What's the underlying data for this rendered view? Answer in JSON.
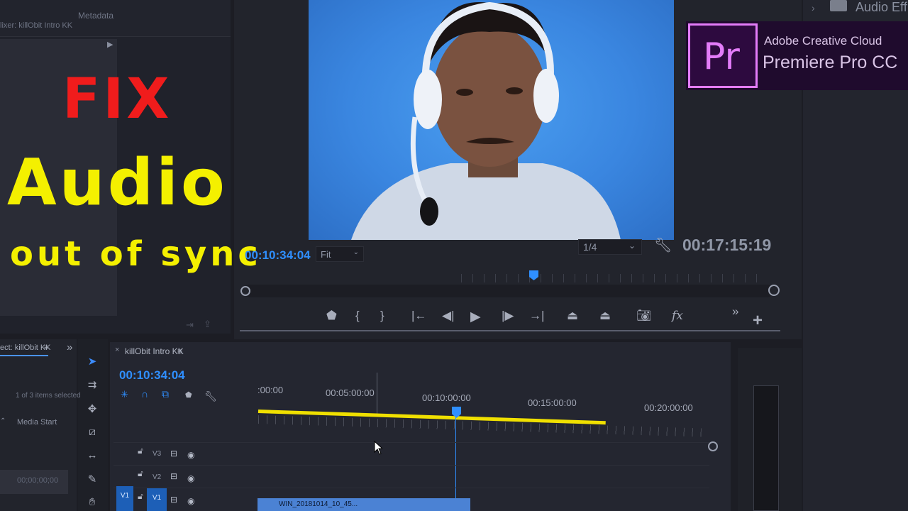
{
  "overlay": {
    "line1": "FIX",
    "line2": "Audio",
    "line3": "out of sync"
  },
  "logo": {
    "badge": "Pr",
    "line1": "Adobe Creative Cloud",
    "line2": "Premiere Pro CC"
  },
  "source_panel": {
    "mixer_label": "lixer: killObit Intro KK",
    "metadata_tab": "Metadata"
  },
  "program_monitor": {
    "current_time": "00:10:34:04",
    "zoom": "Fit",
    "resolution": "1/4",
    "duration": "00:17:15:19"
  },
  "project_panel": {
    "tab": "ect: killObit KK",
    "tab_menu": "≡",
    "expand": "»",
    "items_selected": "1 of 3 items selected",
    "column": "Media Start",
    "zero_time": "00;00;00;00"
  },
  "timeline": {
    "sequence_tab": "killObit Intro KK",
    "current_time": "00:10:34:04",
    "ruler_labels": [
      ":00:00",
      "00:05:00:00",
      "00:10:00:00",
      "00:15:00:00",
      "00:20:00:00"
    ],
    "tracks": [
      {
        "label": "V3"
      },
      {
        "label": "V2"
      },
      {
        "label": "V1"
      }
    ],
    "source_patch": "V1",
    "clip_name": "WIN_20181014_10_45..."
  },
  "right_panel": {
    "audio_label": "Audio Eff"
  }
}
